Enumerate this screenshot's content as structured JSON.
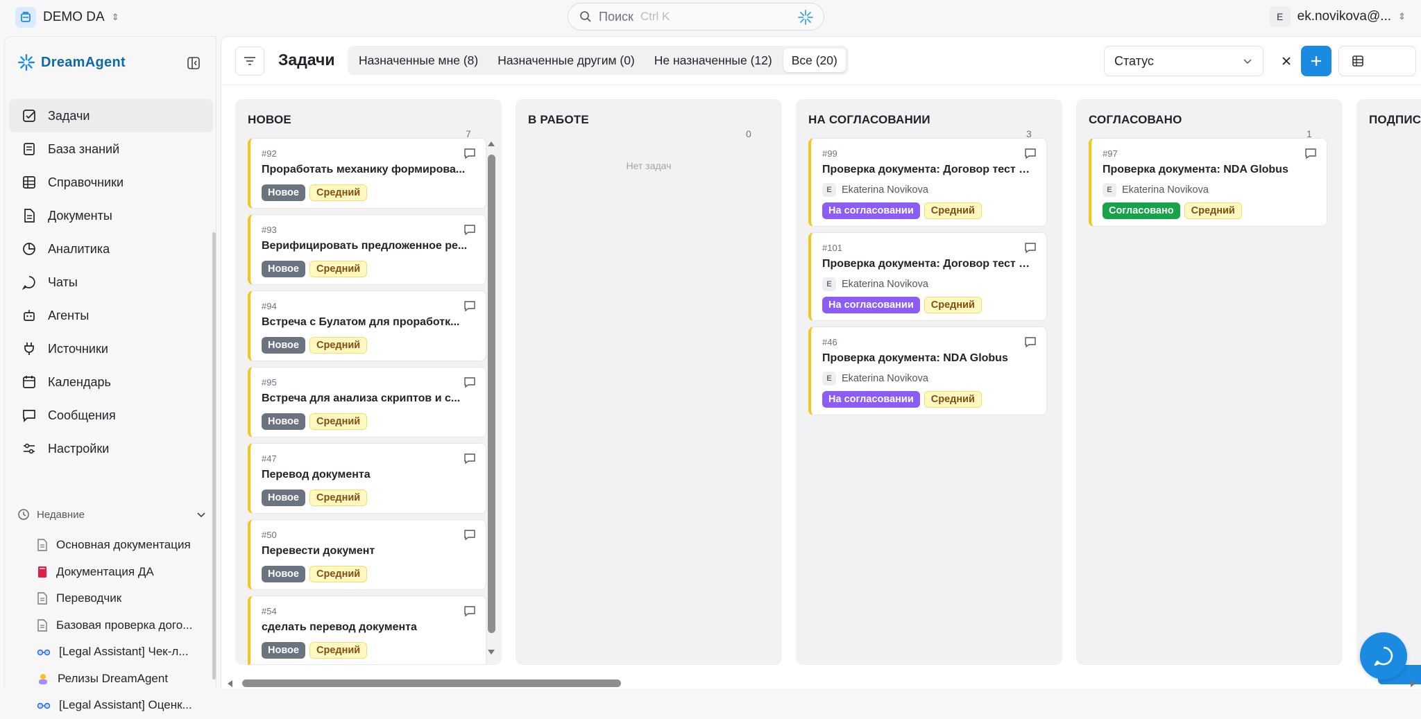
{
  "workspace": {
    "name": "DEMO DA"
  },
  "search": {
    "placeholder": "Поиск",
    "shortcut": "Ctrl K"
  },
  "user": {
    "initial": "E",
    "email": "ek.novikova@..."
  },
  "brand": {
    "name": "DreamAgent",
    "color": "#0b6aa8"
  },
  "sidebar": {
    "items": [
      {
        "label": "Задачи",
        "icon": "check-square-icon",
        "active": true
      },
      {
        "label": "База знаний",
        "icon": "book-icon"
      },
      {
        "label": "Справочники",
        "icon": "grid-table-icon"
      },
      {
        "label": "Документы",
        "icon": "document-icon"
      },
      {
        "label": "Аналитика",
        "icon": "pie-chart-icon"
      },
      {
        "label": "Чаты",
        "icon": "chat-bubble-icon"
      },
      {
        "label": "Агенты",
        "icon": "bot-icon"
      },
      {
        "label": "Источники",
        "icon": "plug-icon"
      },
      {
        "label": "Календарь",
        "icon": "calendar-icon"
      },
      {
        "label": "Сообщения",
        "icon": "message-square-icon"
      },
      {
        "label": "Настройки",
        "icon": "sliders-icon"
      }
    ],
    "recent_label": "Недавние",
    "recent": [
      {
        "label": "Основная документация",
        "icon": "document-icon"
      },
      {
        "label": "Документация ДА",
        "icon": "red-book-icon"
      },
      {
        "label": "Переводчик",
        "icon": "document-icon"
      },
      {
        "label": "Базовая проверка дого...",
        "icon": "document-icon"
      },
      {
        "label": "[Legal Assistant] Чек-л...",
        "icon": "glasses-icon"
      },
      {
        "label": "Релизы DreamAgent",
        "icon": "person-emoji-icon"
      },
      {
        "label": "[Legal Assistant] Оценк...",
        "icon": "glasses-icon"
      }
    ]
  },
  "toolbar": {
    "title": "Задачи",
    "tabs": [
      {
        "label": "Назначенные мне (8)"
      },
      {
        "label": "Назначенные другим (0)"
      },
      {
        "label": "Не назначенные (12)"
      },
      {
        "label": "Все (20)",
        "active": true
      }
    ],
    "status_placeholder": "Статус",
    "accent": "#1a8be0"
  },
  "board": {
    "columns": [
      {
        "title": "НОВОЕ",
        "count": "7",
        "cards": [
          {
            "id": "#92",
            "title": "Проработать механику формирова...",
            "status": "Новое",
            "priority": "Средний"
          },
          {
            "id": "#93",
            "title": "Верифицировать предложенное ре...",
            "status": "Новое",
            "priority": "Средний"
          },
          {
            "id": "#94",
            "title": "Встреча с Булатом для проработк...",
            "status": "Новое",
            "priority": "Средний"
          },
          {
            "id": "#95",
            "title": "Встреча для анализа скриптов и с...",
            "status": "Новое",
            "priority": "Средний"
          },
          {
            "id": "#47",
            "title": "Перевод документа",
            "status": "Новое",
            "priority": "Средний"
          },
          {
            "id": "#50",
            "title": "Перевести документ",
            "status": "Новое",
            "priority": "Средний"
          },
          {
            "id": "#54",
            "title": "сделать перевод документа",
            "status": "Новое",
            "priority": "Средний"
          }
        ]
      },
      {
        "title": "В РАБОТЕ",
        "count": "0",
        "empty": "Нет задач",
        "cards": []
      },
      {
        "title": "НА СОГЛАСОВАНИИ",
        "count": "3",
        "cards": [
          {
            "id": "#99",
            "title": "Проверка документа: Договор тест ко...",
            "assignee_initial": "E",
            "assignee": "Ekaterina Novikova",
            "status": "На согласовании",
            "priority": "Средний"
          },
          {
            "id": "#101",
            "title": "Проверка документа: Договор тест ко...",
            "assignee_initial": "E",
            "assignee": "Ekaterina Novikova",
            "status": "На согласовании",
            "priority": "Средний"
          },
          {
            "id": "#46",
            "title": "Проверка документа: NDA Globus",
            "assignee_initial": "E",
            "assignee": "Ekaterina Novikova",
            "status": "На согласовании",
            "priority": "Средний"
          }
        ]
      },
      {
        "title": "СОГЛАСОВАНО",
        "count": "1",
        "cards": [
          {
            "id": "#97",
            "title": "Проверка документа: NDA Globus",
            "assignee_initial": "E",
            "assignee": "Ekaterina Novikova",
            "status": "Согласовано",
            "priority": "Средний"
          }
        ]
      },
      {
        "title": "ПОДПИС",
        "count": "",
        "cards": []
      }
    ]
  },
  "colors": {
    "status_new": "#6b7280",
    "status_review": "#8b5cf6",
    "status_approved": "#16a34a",
    "priority_medium": "#fef9c3",
    "card_accent": "#f5c518"
  }
}
